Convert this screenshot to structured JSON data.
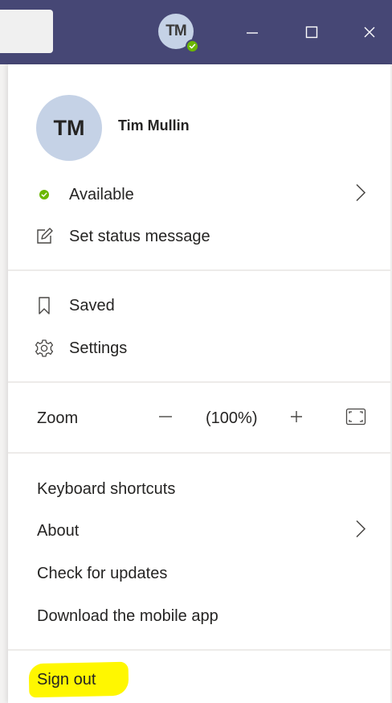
{
  "titlebar": {
    "avatar_initials": "TM",
    "presence_color": "#6bb700",
    "icons": [
      "minimize-icon",
      "maximize-icon",
      "close-icon"
    ]
  },
  "profile": {
    "initials": "TM",
    "name": "Tim Mullin",
    "status": "Available",
    "status_color": "#6bb700",
    "set_status": "Set status message"
  },
  "menu": {
    "saved": "Saved",
    "settings": "Settings",
    "zoom_label": "Zoom",
    "zoom_minus": "—",
    "zoom_value": "(100%)",
    "zoom_plus": "+",
    "keyboard_shortcuts": "Keyboard shortcuts",
    "about": "About",
    "check_updates": "Check for updates",
    "download_app": "Download the mobile app",
    "sign_out": "Sign out"
  },
  "colors": {
    "titlebar": "#464775",
    "highlight": "#fff700",
    "avatar_bg": "#c5d2e6"
  }
}
